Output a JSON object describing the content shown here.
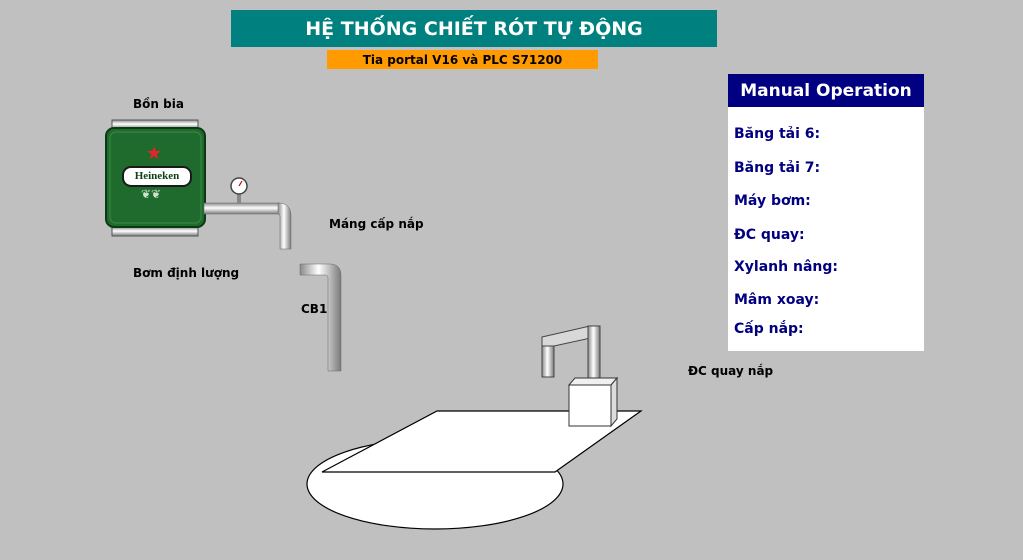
{
  "header": {
    "title": "HỆ THỐNG CHIẾT RÓT TỰ ĐỘNG",
    "subtitle": "Tia portal V16 và PLC S71200"
  },
  "labels": {
    "tank": "Bồn bia",
    "cap_chute": "Máng cấp nắp",
    "metering_pump": "Bơm định lượng",
    "sensor": "CB1",
    "cap_motor": "ĐC quay nắp"
  },
  "tank_logo": {
    "brand": "Heineken",
    "star_color": "#e8242b",
    "body_color": "#1f6b2e"
  },
  "manual": {
    "title": "Manual Operation",
    "items": [
      "Băng tải 6:",
      "Băng tải 7:",
      "Máy bơm:",
      "ĐC quay:",
      "Xylanh nâng:",
      "Mâm xoay:",
      "Cấp nắp:"
    ]
  }
}
